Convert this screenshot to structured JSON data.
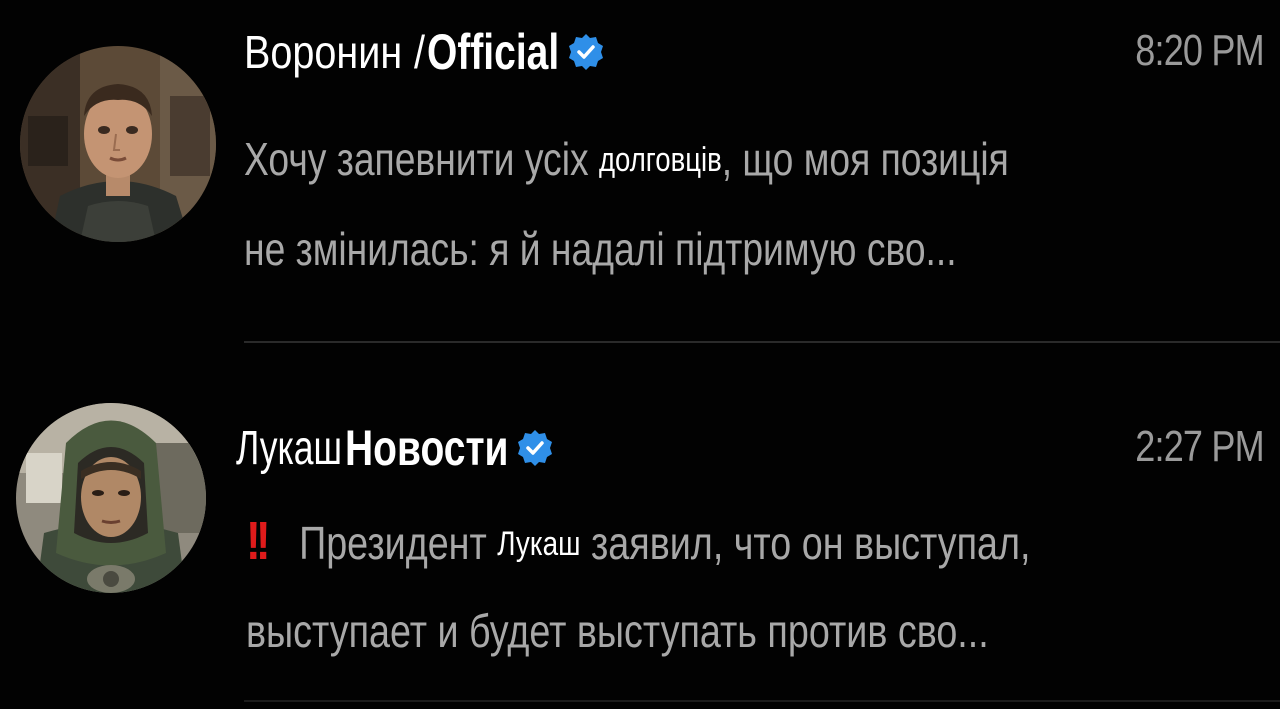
{
  "chats": [
    {
      "name_part_a": "Воронин",
      "name_separator": "/",
      "name_part_b": "Official",
      "timestamp": "8:20 PM",
      "message_line1_prefix": "Хочу запевнити усіх",
      "message_line1_highlight": "долговців",
      "message_line1_suffix": ", що моя позиція",
      "message_line2": "не змінилась: я й надалі підтримую сво...",
      "avatar_icon": "stalker-character-avatar",
      "verified_icon": "verified-badge-icon"
    },
    {
      "name_part_a": "Лукаш",
      "name_part_b": "Новости",
      "timestamp": "2:27 PM",
      "alert": "!!",
      "message_line1_prefix": "Президент",
      "message_line1_highlight": "Лукаш",
      "message_line1_suffix": "заявил, что он выступал,",
      "message_line2": "выступает и будет выступать против сво...",
      "avatar_icon": "hooded-stalker-avatar",
      "verified_icon": "verified-badge-icon"
    }
  ],
  "colors": {
    "background": "#020202",
    "verified_badge": "#2f8fe8",
    "alert": "#e01b1b",
    "message_text": "#a8a8a8"
  }
}
